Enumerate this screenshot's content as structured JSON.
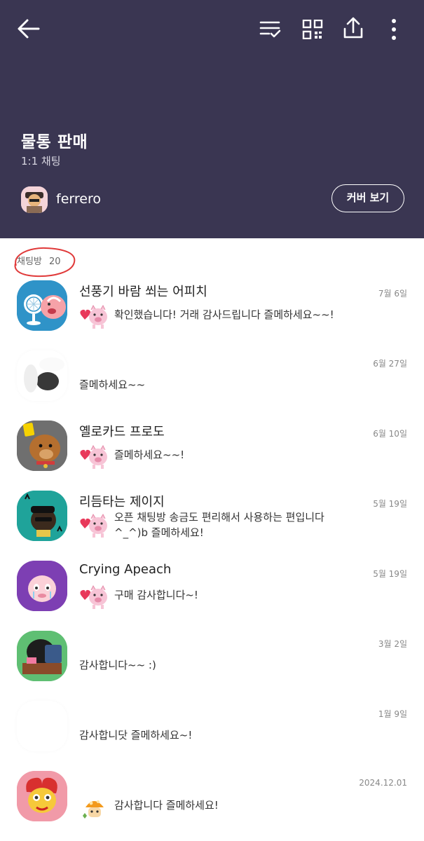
{
  "header": {
    "back_icon": "arrow-left-icon",
    "icons": [
      "list-check-icon",
      "qr-code-icon",
      "share-icon",
      "more-vertical-icon"
    ],
    "title": "물통 판매",
    "subtitle": "1:1 채팅",
    "owner_name": "ferrero",
    "cover_button": "커버 보기",
    "bg_color": "#3a3652"
  },
  "section": {
    "label": "채팅방",
    "count": "20"
  },
  "chats": [
    {
      "name": "선풍기 바람 쐬는 어피치",
      "date": "7월 6일",
      "message": "확인했습니다! 거래 감사드립니다 즐메하세요~~!",
      "avatar": "apeach-fan"
    },
    {
      "name": "",
      "date": "6월 27일",
      "message": "즐메하세요~~",
      "avatar": "blurred"
    },
    {
      "name": "옐로카드 프로도",
      "date": "6월 10일",
      "message": "즐메하세요~~!",
      "avatar": "frodo-yellowcard"
    },
    {
      "name": "리듬타는 제이지",
      "date": "5월 19일",
      "message_line1": "오픈 채팅방 송금도 편리해서 사용하는 편입니다",
      "message_line2": "^_^)b 즐메하세요!",
      "avatar": "jayg-rhythm"
    },
    {
      "name": "Crying Apeach",
      "date": "5월 19일",
      "message": "구매 감사합니다~!",
      "avatar": "crying-apeach"
    },
    {
      "name": "",
      "date": "3월 2일",
      "message": "감사합니다~~ :)",
      "avatar": "desk-character"
    },
    {
      "name": "",
      "date": "1월 9일",
      "message": "감사합니닷 즐메하세요~!",
      "avatar": "blank"
    },
    {
      "name": "",
      "date": "2024.12.01",
      "message": "감사합니다 즐메하세요!",
      "avatar": "muzi-character"
    }
  ]
}
